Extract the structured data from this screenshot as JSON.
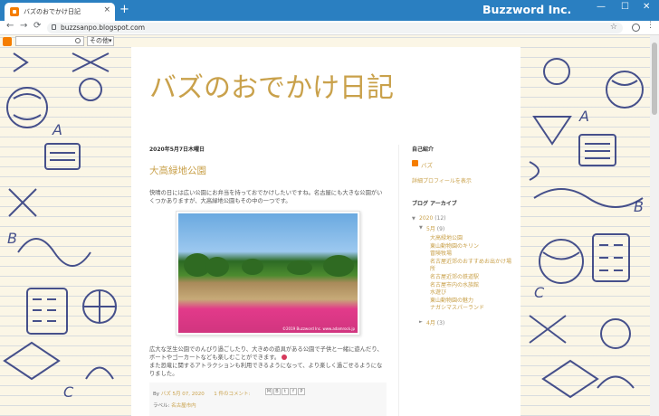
{
  "browser": {
    "tab_title": "バズのおでかけ日記",
    "tab_close": "×",
    "new_tab": "+",
    "brand": "Buzzword Inc.",
    "url": "buzzsanpo.blogspot.com",
    "controls": {
      "minimize": "—",
      "maximize": "☐",
      "close": "✕"
    },
    "nav": {
      "back": "←",
      "forward": "→",
      "reload": "⟳"
    },
    "star": "☆",
    "menu": "⋮"
  },
  "blogger_bar": {
    "more_label": "その他▾"
  },
  "blog": {
    "title": "バズのおでかけ日記"
  },
  "post": {
    "date": "2020年5月7日木曜日",
    "title": "大高緑地公園",
    "intro": "快晴の日には広い公園にお弁当を持っておでかけしたいですね。名古屋にも大きな公園がいくつかありますが、大高緑地公園もその中の一つです。",
    "photo_caption": "©2019 Buzzword Inc. www.adamrock.jp",
    "body": "広大な芝生公園でのんびり過ごしたり、大きめの遊具がある公園で子供と一緒に遊んだり、ボートやゴーカートなども楽しむことができます。",
    "body2": "また恐竜に関するアトラクションも利用できるようになって、より楽しく過ごせるようになりました。",
    "footer": {
      "by": "By",
      "author": "バズ",
      "time": "5月 07, 2020",
      "comments": "1 件のコメント:",
      "share_buttons": [
        "M",
        "B",
        "t",
        "f",
        "P"
      ],
      "labels_prefix": "ラベル:",
      "label": "名古屋市内"
    }
  },
  "sidebar": {
    "profile_heading": "自己紹介",
    "profile_name": "バズ",
    "profile_link": "詳細プロフィールを表示",
    "archive_heading": "ブログ アーカイブ",
    "year": {
      "toggle": "▼",
      "label": "2020",
      "count": "(12)"
    },
    "month": {
      "toggle": "▼",
      "label": "5月",
      "count": "(9)"
    },
    "posts": [
      "大高緑地公園",
      "東山動物園のキリン",
      "冒険牧場",
      "名古屋近郊のおすすめお出かけ場所",
      "名古屋近郊の鉄道駅",
      "名古屋市内の水族館",
      "水遊び",
      "東山動物園の魅力",
      "ナガシマスパーランド"
    ],
    "prev_month": {
      "toggle": "►",
      "label": "4月",
      "count": "(3)"
    }
  },
  "colors": {
    "accent": "#c9a14b",
    "chrome": "#2a7fc1",
    "blogger_orange": "#f57d00"
  }
}
